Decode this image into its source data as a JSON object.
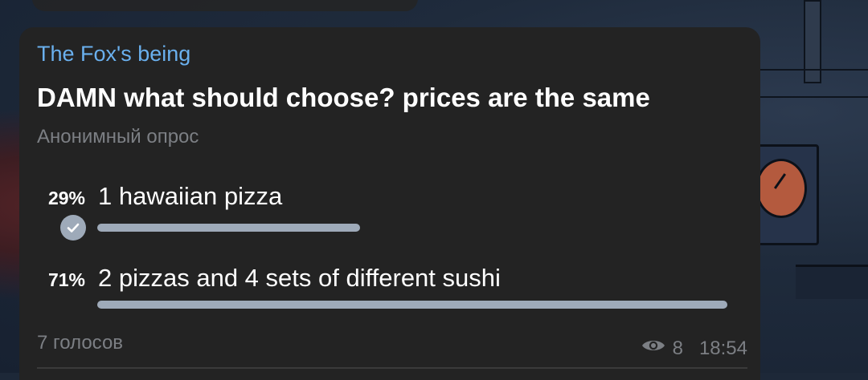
{
  "message": {
    "author": "The Fox's being",
    "question": "DAMN what should choose? prices are the same",
    "poll_type": "Анонимный опрос"
  },
  "poll": {
    "options": [
      {
        "percent_label": "29%",
        "text": "1 hawaiian pizza",
        "share": 0.29,
        "selected": true
      },
      {
        "percent_label": "71%",
        "text": "2 pizzas and 4 sets of different sushi",
        "share": 0.71,
        "selected": false
      }
    ],
    "votes_label": "7 голосов"
  },
  "footer": {
    "views": "8",
    "time": "18:54"
  },
  "icons": {
    "selected_check": "check-circle-icon",
    "views": "eye-icon"
  },
  "colors": {
    "author": "#6ab0ee",
    "bubble": "#232323",
    "bar": "#9eaab9",
    "muted_text": "#7c7f84"
  }
}
